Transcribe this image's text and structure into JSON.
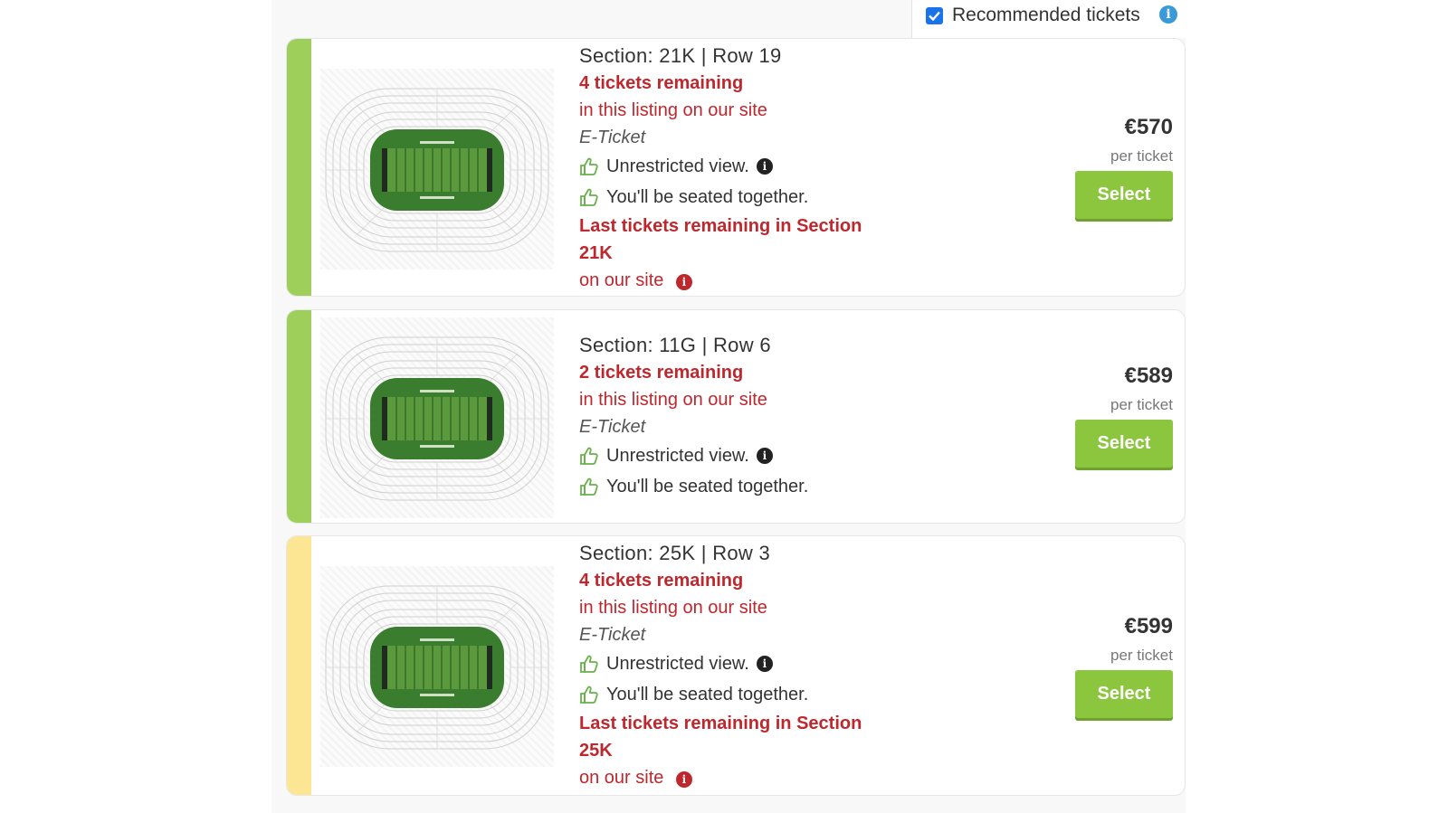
{
  "filter": {
    "recommended_label": "Recommended tickets",
    "recommended_checked": true,
    "info_icon": "info-icon"
  },
  "colors": {
    "strip_green": "#9dcf5a",
    "strip_yellow": "#fce593",
    "red_text": "#c0272d",
    "select_button": "#8cc63f",
    "pitch_green": "#3a7d2f"
  },
  "listings": [
    {
      "section_title": "Section: 21K | Row 19",
      "tickets_remaining": "4 tickets remaining",
      "listing_note": "in this listing on our site",
      "ticket_type": "E-Ticket",
      "features": [
        "Unrestricted view.",
        "You'll be seated together."
      ],
      "last_tickets_line1": "Last tickets remaining in Section",
      "last_tickets_line2": "21K",
      "last_tickets_note": "on our site",
      "price": "€570",
      "per_ticket": "per ticket",
      "select_label": "Select",
      "strip_color": "green"
    },
    {
      "section_title": "Section: 11G | Row 6",
      "tickets_remaining": "2 tickets remaining",
      "listing_note": "in this listing on our site",
      "ticket_type": "E-Ticket",
      "features": [
        "Unrestricted view.",
        "You'll be seated together."
      ],
      "price": "€589",
      "per_ticket": "per ticket",
      "select_label": "Select",
      "strip_color": "green"
    },
    {
      "section_title": "Section: 25K | Row 3",
      "tickets_remaining": "4 tickets remaining",
      "listing_note": "in this listing on our site",
      "ticket_type": "E-Ticket",
      "features": [
        "Unrestricted view.",
        "You'll be seated together."
      ],
      "last_tickets_line1": "Last tickets remaining in Section",
      "last_tickets_line2": "25K",
      "last_tickets_note": "on our site",
      "price": "€599",
      "per_ticket": "per ticket",
      "select_label": "Select",
      "strip_color": "yellow"
    }
  ]
}
